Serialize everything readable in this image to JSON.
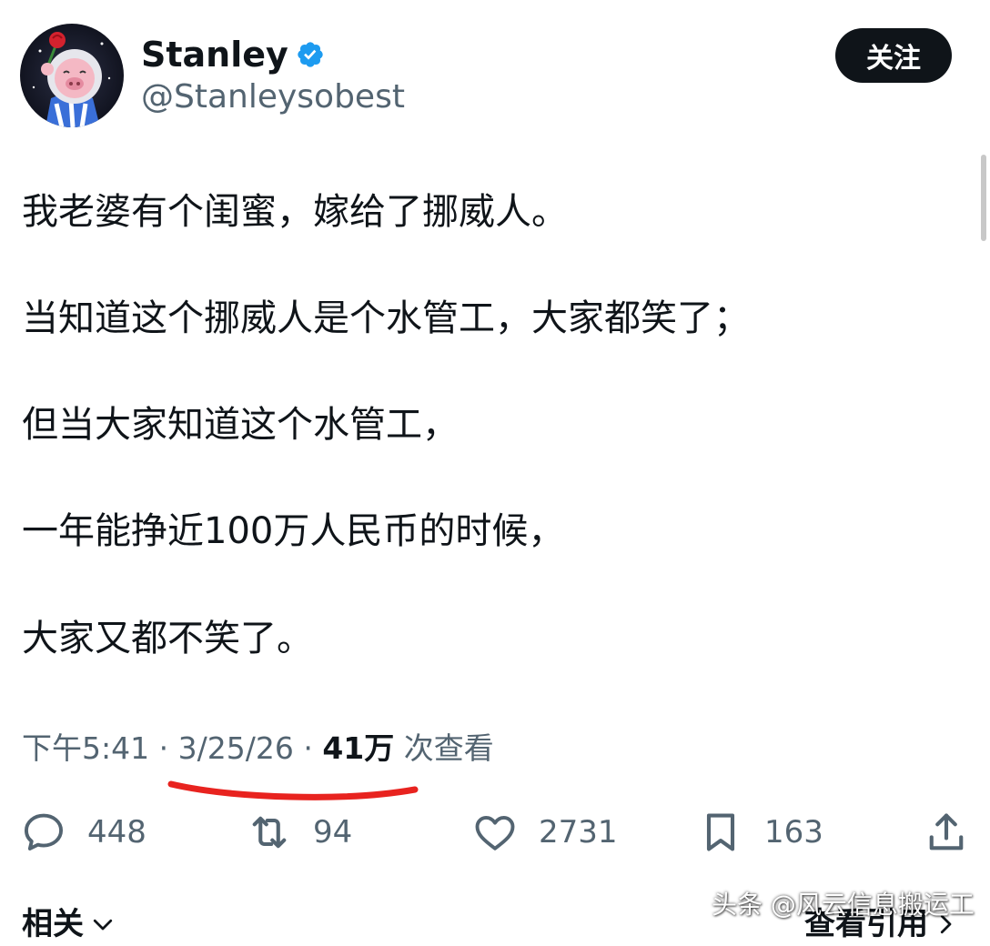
{
  "header": {
    "display_name": "Stanley",
    "handle": "@Stanleysobest",
    "follow_label": "关注"
  },
  "tweet": {
    "lines": [
      "我老婆有个闺蜜，嫁给了挪威人。",
      "当知道这个挪威人是个水管工，大家都笑了；",
      "但当大家知道这个水管工，",
      "一年能挣近100万人民币的时候，",
      "大家又都不笑了。"
    ]
  },
  "meta": {
    "time": "下午5:41",
    "separator": "·",
    "date": "3/25/26",
    "views_count": "41万",
    "views_label": "次查看"
  },
  "actions": {
    "replies": "448",
    "retweets": "94",
    "likes": "2731",
    "bookmarks": "163"
  },
  "footer": {
    "related_label": "相关",
    "view_quotes_label": "查看引用"
  },
  "watermark": {
    "text": "头条 @风云信息搬运工"
  },
  "colors": {
    "accent_blue": "#1d9bf0",
    "text_primary": "#0f1419",
    "text_secondary": "#536471",
    "underline_red": "#e8231f"
  }
}
